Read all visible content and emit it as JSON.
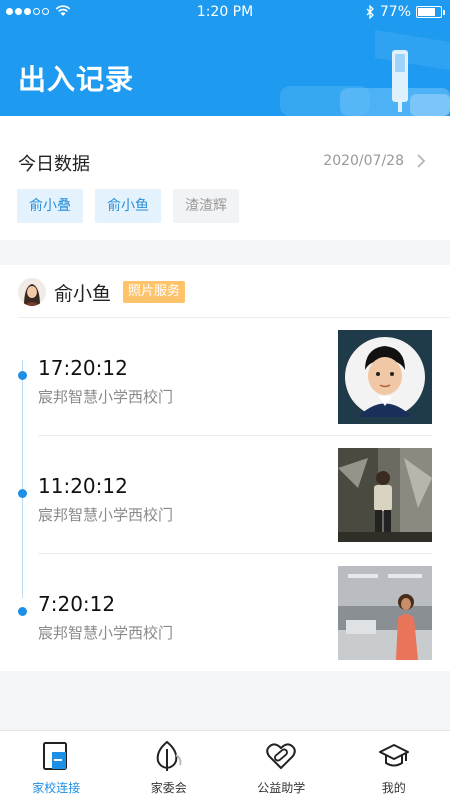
{
  "status_bar": {
    "time": "1:20 PM",
    "battery": "77%",
    "battery_level": 0.77
  },
  "header": {
    "title": "出入记录"
  },
  "today": {
    "title": "今日数据",
    "date": "2020/07/28",
    "children": [
      {
        "name": "俞小叠",
        "active": true
      },
      {
        "name": "俞小鱼",
        "active": true
      },
      {
        "name": "渣渣辉",
        "active": false
      }
    ]
  },
  "records": {
    "child_name": "俞小鱼",
    "service_badge": "照片服务",
    "items": [
      {
        "time": "17:20:12",
        "location": "宸邦智慧小学西校门"
      },
      {
        "time": "11:20:12",
        "location": "宸邦智慧小学西校门"
      },
      {
        "time": "7:20:12",
        "location": "宸邦智慧小学西校门"
      }
    ]
  },
  "tabbar": {
    "tabs": [
      {
        "label": "家校连接",
        "icon": "phone-book-icon"
      },
      {
        "label": "家委会",
        "icon": "leaf-icon"
      },
      {
        "label": "公益助学",
        "icon": "heart-bandage-icon"
      },
      {
        "label": "我的",
        "icon": "graduation-cap-icon"
      }
    ]
  },
  "colors": {
    "brand": "#1e9bf0",
    "accent": "#1e8fe6",
    "badge": "#ffc46b"
  }
}
